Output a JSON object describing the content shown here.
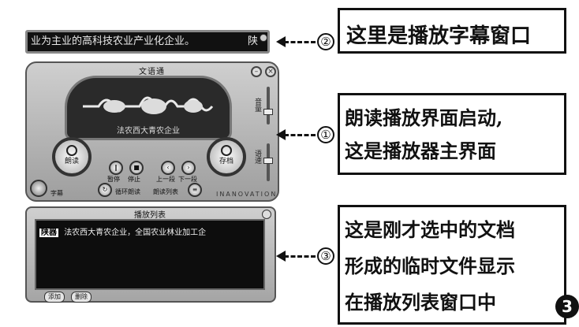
{
  "subtitle_window": {
    "text": "业为主业的高科技农业产业化企业。",
    "tail": "陕"
  },
  "player": {
    "title": "文语通",
    "screen_text": "法农西大青农企业",
    "close_glyph": "×",
    "min_glyph": "–",
    "slider_volume_label": "音量",
    "slider_speed_label": "语速",
    "left_big_label": "朗读",
    "right_big_label": "存档",
    "buttons": [
      "暂停",
      "停止",
      "上一段",
      "下一段"
    ],
    "bottom_left_label": "循环朗读",
    "bottom_right_label": "朗读列表",
    "knob_label": "字幕",
    "brand": "INANOVATION"
  },
  "playlist": {
    "title": "播放列表",
    "item_tag": "陕器",
    "item_text": "法农西大青农企业，全国农业林业加工企",
    "btn_add": "添加",
    "btn_del": "删除"
  },
  "annotations": [
    {
      "num": "②",
      "lines": [
        "这里是播放字幕窗口"
      ]
    },
    {
      "num": "①",
      "lines": [
        "朗读播放界面启动,",
        "这是播放器主界面"
      ]
    },
    {
      "num": "③",
      "lines": [
        "这是刚才选中的文档",
        "形成的临时文件显示",
        "在播放列表窗口中"
      ]
    }
  ],
  "figure_number": "3"
}
